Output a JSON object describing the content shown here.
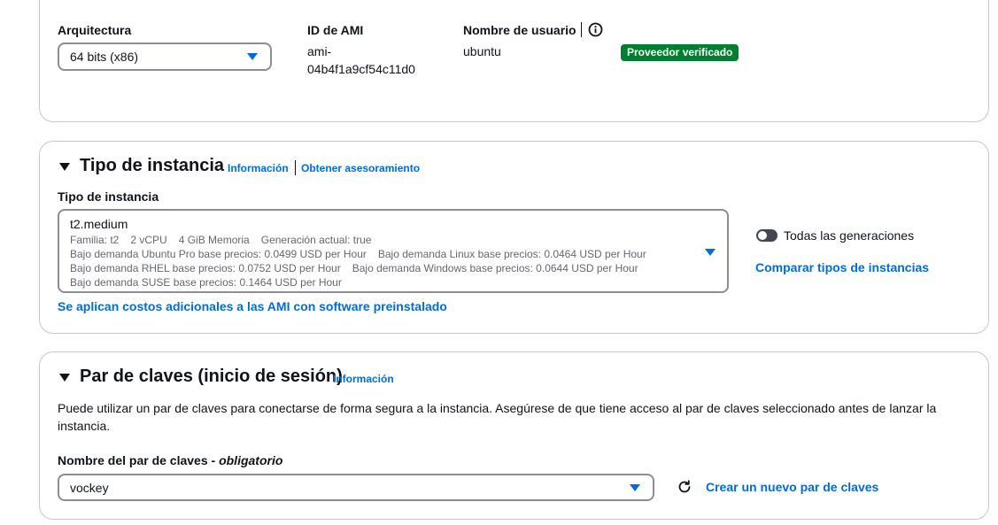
{
  "ami_section": {
    "architecture_label": "Arquitectura",
    "architecture_value": "64 bits (x86)",
    "ami_id_label": "ID de AMI",
    "ami_id_line1": "ami-",
    "ami_id_line2": "04b4f1a9cf54c11d0",
    "username_label": "Nombre de usuario",
    "username_value": "ubuntu",
    "verified_badge": "Proveedor verificado"
  },
  "instance_section": {
    "title": "Tipo de instancia",
    "info_link": "Información",
    "advice_link": "Obtener asesoramiento",
    "field_label": "Tipo de instancia",
    "selected_type": "t2.medium",
    "details": {
      "family": "Familia: t2",
      "vcpu": "2 vCPU",
      "memory": "4 GiB Memoria",
      "current_gen": "Generación actual: true",
      "ubuntu_pro_price": "Bajo demanda Ubuntu Pro base precios: 0.0499 USD per Hour",
      "linux_price": "Bajo demanda Linux base precios: 0.0464 USD per Hour",
      "rhel_price": "Bajo demanda RHEL base precios: 0.0752 USD per Hour",
      "windows_price": "Bajo demanda Windows base precios: 0.0644 USD per Hour",
      "suse_price": "Bajo demanda SUSE base precios: 0.1464 USD per Hour"
    },
    "all_generations_toggle": "Todas las generaciones",
    "all_generations_on": false,
    "compare_link": "Comparar tipos de instancias",
    "ami_costs_link": "Se aplican costos adicionales a las AMI con software preinstalado"
  },
  "keypair_section": {
    "title": "Par de claves (inicio de sesión)",
    "info_link": "Información",
    "description": "Puede utilizar un par de claves para conectarse de forma segura a la instancia. Asegúrese de que tiene acceso al par de claves seleccionado antes de lanzar la instancia.",
    "field_label": "Nombre del par de claves - ",
    "field_required": "obligatorio",
    "selected_key": "vockey",
    "create_link": "Crear un nuevo par de claves"
  },
  "colors": {
    "link": "#006ce0",
    "badge_green": "#00802f",
    "border": "#c6c6cd"
  }
}
